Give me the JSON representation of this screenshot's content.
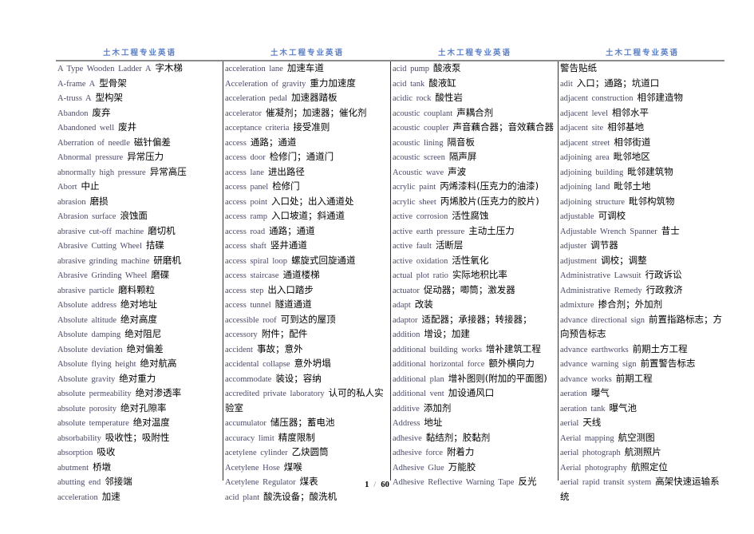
{
  "document": {
    "running_header": "土木工程专业英语",
    "page_current": "1",
    "page_separator": "/",
    "page_total": "60"
  },
  "columns": [
    {
      "entries": [
        {
          "en": "A Type Wooden Ladder A",
          "zh": "字木梯"
        },
        {
          "en": "A-frame A",
          "zh": "型骨架"
        },
        {
          "en": "A-truss A",
          "zh": "型构架"
        },
        {
          "en": "Abandon",
          "zh": "废弃"
        },
        {
          "en": "Abandoned well",
          "zh": "废井"
        },
        {
          "en": "Aberration of needle",
          "zh": "磁针偏差"
        },
        {
          "en": "Abnormal pressure",
          "zh": "异常压力"
        },
        {
          "en": "abnormally high pressure",
          "zh": "异常高压"
        },
        {
          "en": "Abort",
          "zh": "中止"
        },
        {
          "en": "abrasion",
          "zh": "磨损"
        },
        {
          "en": "Abrasion surface",
          "zh": "浪蚀面"
        },
        {
          "en": "abrasive cut-off machine",
          "zh": "磨切机"
        },
        {
          "en": "Abrasive Cutting Wheel",
          "zh": "拮碟"
        },
        {
          "en": "abrasive grinding machine",
          "zh": "研磨机"
        },
        {
          "en": "Abrasive Grinding Wheel",
          "zh": "磨碟"
        },
        {
          "en": "abrasive particle",
          "zh": "磨料颗粒"
        },
        {
          "en": "Absolute address",
          "zh": "绝对地址"
        },
        {
          "en": "Absolute altitude",
          "zh": "绝对高度"
        },
        {
          "en": "Absolute damping",
          "zh": "绝对阻尼"
        },
        {
          "en": "Absolute deviation",
          "zh": "绝对偏差"
        },
        {
          "en": "Absolute flying height",
          "zh": "绝对航高"
        },
        {
          "en": "Absolute gravity",
          "zh": "绝对重力"
        },
        {
          "en": "absolute permeability",
          "zh": "绝对渗透率"
        },
        {
          "en": "absolute porosity",
          "zh": "绝对孔隙率"
        },
        {
          "en": "absolute temperature",
          "zh": "绝对温度"
        },
        {
          "en": "absorbability",
          "zh": "吸收性；吸附性"
        },
        {
          "en": "absorption",
          "zh": "吸收"
        },
        {
          "en": "abutment",
          "zh": "桥墩"
        },
        {
          "en": "abutting end",
          "zh": "邻接端"
        },
        {
          "en": "acceleration",
          "zh": "加速"
        }
      ]
    },
    {
      "entries": [
        {
          "en": "acceleration lane",
          "zh": "加速车道"
        },
        {
          "en": "Acceleration of gravity",
          "zh": "重力加速度"
        },
        {
          "en": "acceleration pedal",
          "zh": "加速器踏板"
        },
        {
          "en": "accelerator",
          "zh": "催凝剂；加速器；催化剂"
        },
        {
          "en": "acceptance criteria",
          "zh": "接受准则"
        },
        {
          "en": "access",
          "zh": "通路；通道"
        },
        {
          "en": "access door",
          "zh": "检修门；通道门"
        },
        {
          "en": "access lane",
          "zh": "进出路径"
        },
        {
          "en": "access panel",
          "zh": "检修门"
        },
        {
          "en": "access point",
          "zh": "入口处；出入通道处"
        },
        {
          "en": "access ramp",
          "zh": "入口坡道；斜通道"
        },
        {
          "en": "access road",
          "zh": "通路；通道"
        },
        {
          "en": "access shaft",
          "zh": "竖井通道"
        },
        {
          "en": "access spiral loop",
          "zh": "螺旋式回旋通道"
        },
        {
          "en": "access staircase",
          "zh": "通道楼梯"
        },
        {
          "en": "access step",
          "zh": "出入口踏步"
        },
        {
          "en": "access tunnel",
          "zh": "隧道通道"
        },
        {
          "en": "accessible roof",
          "zh": "可到达的屋顶"
        },
        {
          "en": "accessory",
          "zh": "附件；配件"
        },
        {
          "en": "accident",
          "zh": "事故；意外"
        },
        {
          "en": "accidental collapse",
          "zh": "意外坍塌"
        },
        {
          "en": "accommodate",
          "zh": "装设；容纳"
        },
        {
          "en": "accredited private laboratory",
          "zh": "认可的私人实验室"
        },
        {
          "en": "accumulator",
          "zh": "储压器；蓄电池"
        },
        {
          "en": "accuracy limit",
          "zh": "精度限制"
        },
        {
          "en": "acetylene cylinder",
          "zh": "乙炔圆筒"
        },
        {
          "en": "Acetylene Hose",
          "zh": "煤喉"
        },
        {
          "en": "Acetylene Regulator",
          "zh": "煤表"
        },
        {
          "en": "acid plant",
          "zh": "酸洗设备；酸洗机"
        }
      ]
    },
    {
      "entries": [
        {
          "en": "acid pump",
          "zh": "酸液泵"
        },
        {
          "en": "acid tank",
          "zh": "酸液缸"
        },
        {
          "en": "acidic rock",
          "zh": "酸性岩"
        },
        {
          "en": "acoustic couplant",
          "zh": "声耦合剂"
        },
        {
          "en": "acoustic coupler",
          "zh": "声音藕合器；音效藕合器"
        },
        {
          "en": "acoustic lining",
          "zh": "隔音板"
        },
        {
          "en": "acoustic screen",
          "zh": "隔声屏"
        },
        {
          "en": "Acoustic wave",
          "zh": "声波"
        },
        {
          "en": "acrylic paint",
          "zh": "丙烯漆料(压克力的油漆)"
        },
        {
          "en": "acrylic sheet",
          "zh": "丙烯胶片(压克力的胶片)"
        },
        {
          "en": "active corrosion",
          "zh": "活性腐蚀"
        },
        {
          "en": "active earth pressure",
          "zh": "主动土压力"
        },
        {
          "en": "active fault",
          "zh": "活断层"
        },
        {
          "en": "active oxidation",
          "zh": "活性氧化"
        },
        {
          "en": "actual plot ratio",
          "zh": "实际地积比率"
        },
        {
          "en": "actuator",
          "zh": "促动器；唧筒；激发器"
        },
        {
          "en": "adapt",
          "zh": "改装"
        },
        {
          "en": "adaptor",
          "zh": "适配器；承接器；转接器；"
        },
        {
          "en": "addition",
          "zh": "增设；加建"
        },
        {
          "en": "additional building works",
          "zh": "增补建筑工程"
        },
        {
          "en": "additional horizontal force",
          "zh": "额外横向力"
        },
        {
          "en": "additional plan",
          "zh": "增补图则(附加的平面图)"
        },
        {
          "en": "additional vent",
          "zh": "加设通风口"
        },
        {
          "en": "additive",
          "zh": "添加剂"
        },
        {
          "en": "Address",
          "zh": "地址"
        },
        {
          "en": "adhesive",
          "zh": "黏结剂；胶黏剂"
        },
        {
          "en": "adhesive force",
          "zh": "附着力"
        },
        {
          "en": "Adhesive Glue",
          "zh": "万能胶"
        },
        {
          "en": "Adhesive Reflective Warning Tape",
          "zh": "反光"
        }
      ]
    },
    {
      "entries": [
        {
          "en": "",
          "zh": "警告贴纸"
        },
        {
          "en": "adit",
          "zh": "入口；通路；坑道口"
        },
        {
          "en": "adjacent construction",
          "zh": "相邻建造物"
        },
        {
          "en": "adjacent level",
          "zh": "相邻水平"
        },
        {
          "en": "adjacent site",
          "zh": "相邻基地"
        },
        {
          "en": "adjacent street",
          "zh": "相邻街道"
        },
        {
          "en": "adjoining area",
          "zh": "毗邻地区"
        },
        {
          "en": "adjoining building",
          "zh": "毗邻建筑物"
        },
        {
          "en": "adjoining land",
          "zh": "毗邻土地"
        },
        {
          "en": "adjoining structure",
          "zh": "毗邻构筑物"
        },
        {
          "en": "adjustable",
          "zh": "可调校"
        },
        {
          "en": "Adjustable Wrench Spanner",
          "zh": "昔士"
        },
        {
          "en": "adjuster",
          "zh": "调节器"
        },
        {
          "en": "adjustment",
          "zh": "调校；调整"
        },
        {
          "en": "Administrative Lawsuit",
          "zh": "行政诉讼"
        },
        {
          "en": "Administrative Remedy",
          "zh": "行政救济"
        },
        {
          "en": "admixture",
          "zh": "掺合剂；外加剂"
        },
        {
          "en": "advance directional sign",
          "zh": "前置指路标志；方向预告标志"
        },
        {
          "en": "advance earthworks",
          "zh": "前期土方工程"
        },
        {
          "en": "advance warning sign",
          "zh": "前置警告标志"
        },
        {
          "en": "advance works",
          "zh": "前期工程"
        },
        {
          "en": "aeration",
          "zh": "曝气"
        },
        {
          "en": "aeration tank",
          "zh": "曝气池"
        },
        {
          "en": "aerial",
          "zh": "天线"
        },
        {
          "en": "Aerial mapping",
          "zh": "航空测图"
        },
        {
          "en": "aerial photograph",
          "zh": "航测照片"
        },
        {
          "en": "Aerial photography",
          "zh": "航照定位"
        },
        {
          "en": "aerial rapid transit system",
          "zh": "高架快速运输系统"
        }
      ]
    }
  ]
}
